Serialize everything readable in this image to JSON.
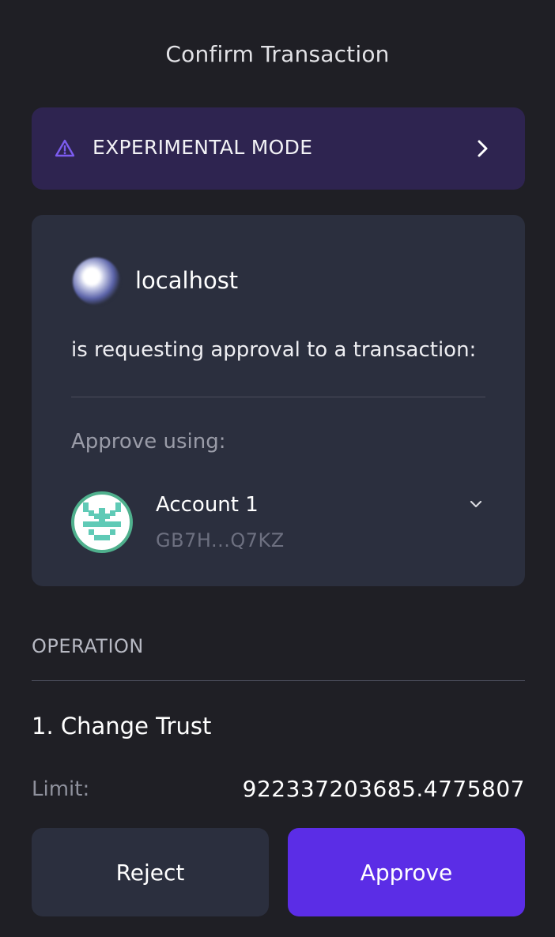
{
  "header": {
    "title": "Confirm Transaction"
  },
  "banner": {
    "label": "EXPERIMENTAL MODE",
    "icon": "warning-triangle-icon",
    "accent": "#7c5cf0"
  },
  "request": {
    "site_name": "localhost",
    "message": "is requesting approval to a transaction:",
    "approve_using_label": "Approve using:"
  },
  "account": {
    "name": "Account 1",
    "address": "GB7H...Q7KZ",
    "ring_color": "#4fb08d",
    "identicon_color": "#5fcab6"
  },
  "operation": {
    "section_label": "OPERATION",
    "title": "1. Change Trust",
    "limit_label": "Limit:",
    "limit_value": "922337203685.4775807"
  },
  "actions": {
    "reject_label": "Reject",
    "approve_label": "Approve",
    "approve_color": "#5b2de6"
  }
}
